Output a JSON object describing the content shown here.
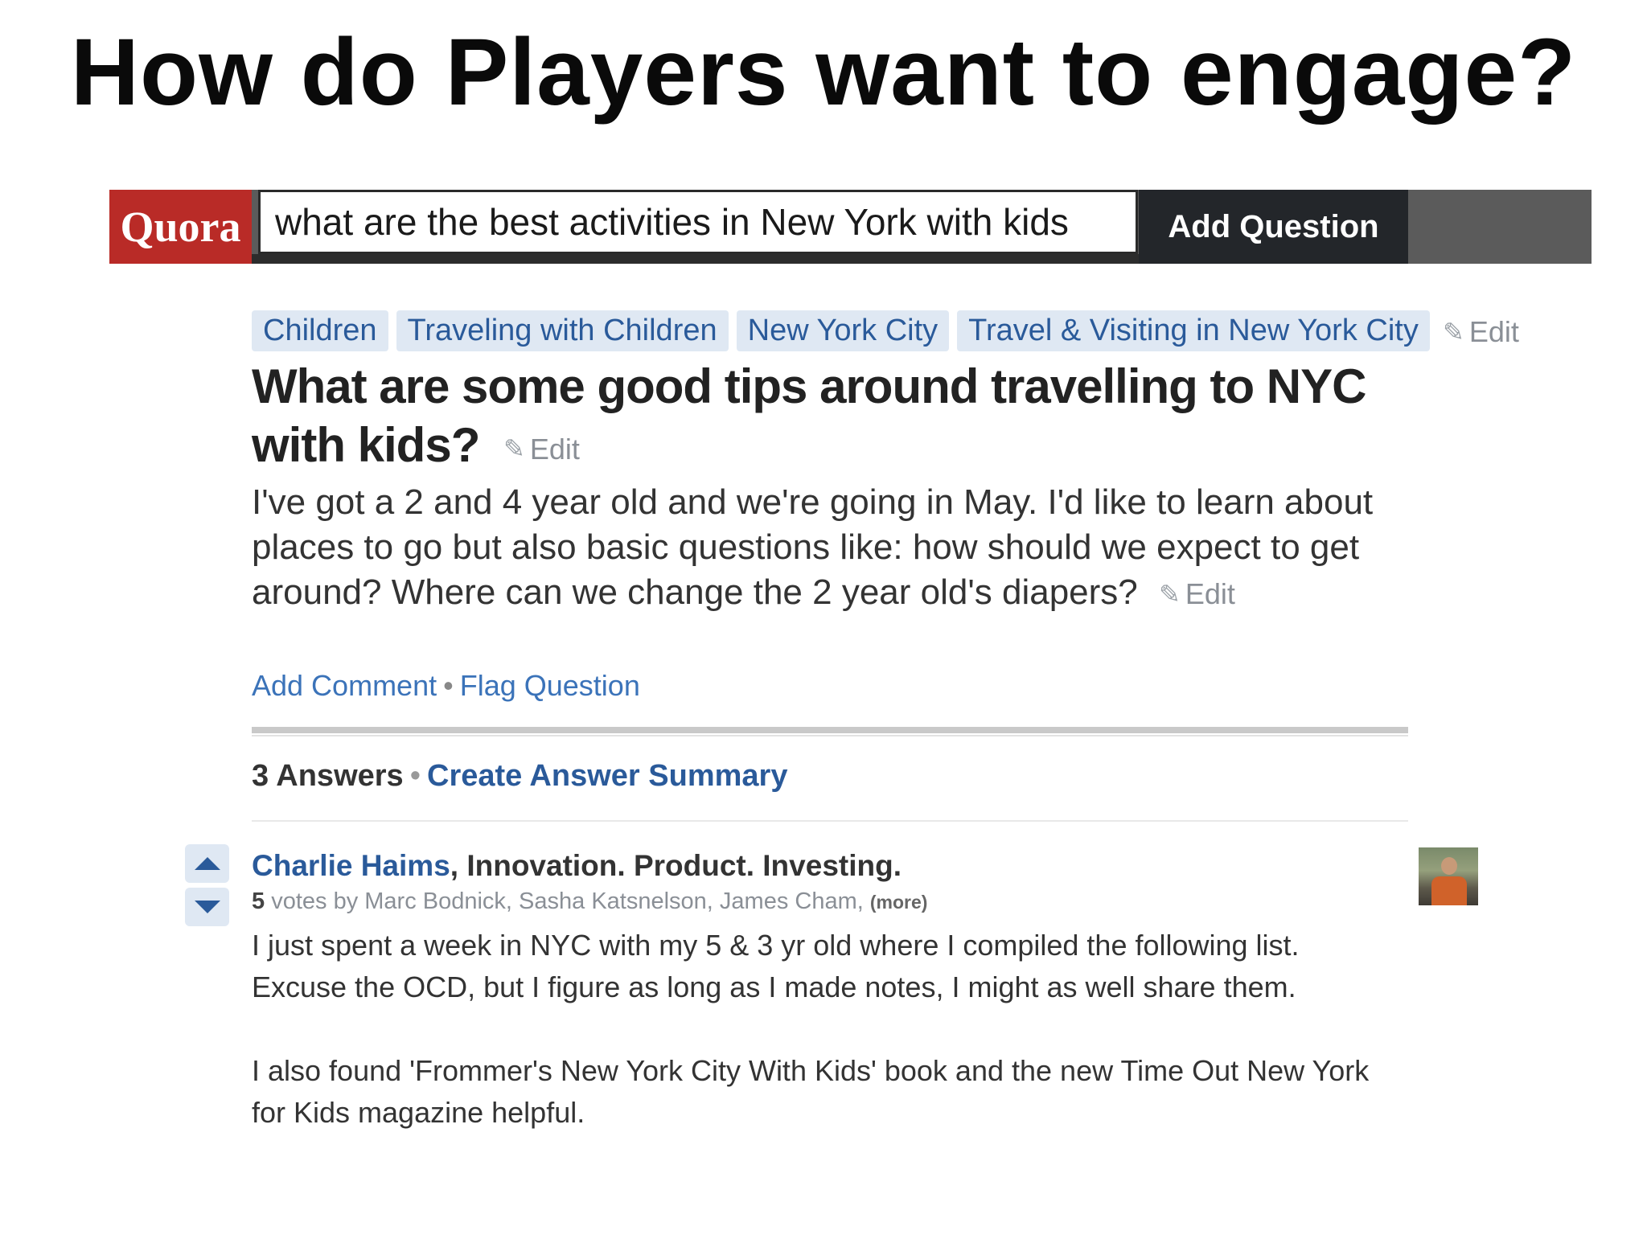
{
  "slide": {
    "title": "How do Players want to engage?"
  },
  "header": {
    "logo": "Quora",
    "search_value": "what are the best activities in New York with kids",
    "add_question_label": "Add Question"
  },
  "topics": [
    "Children",
    "Traveling with Children",
    "New York City",
    "Travel & Visiting in New York City"
  ],
  "edit_label": "Edit",
  "question": {
    "title": "What are some good tips around travelling to NYC with kids?",
    "details": "I've got a 2 and 4 year old and we're going in May. I'd like to learn about places to go but also basic questions like: how should we expect to get around? Where can we change the 2 year old's diapers?",
    "add_comment": "Add Comment",
    "separator": "•",
    "flag_question": "Flag Question"
  },
  "answers": {
    "count_label": "3 Answers",
    "create_summary": "Create Answer Summary"
  },
  "answer": {
    "author_name": "Charlie Haims",
    "author_bio": ", Innovation. Product. Investing.",
    "vote_count": "5",
    "votes_text": " votes by Marc Bodnick, Sasha Katsnelson, James Cham, ",
    "more": "(more)",
    "body": [
      "I just spent a week in NYC with my 5 & 3 yr old where I compiled the following list. Excuse the OCD, but I figure as long as I made notes, I might as well share them.",
      "I also found 'Frommer's New York City With Kids' book and the new Time Out New York for Kids magazine helpful."
    ]
  },
  "icons": {
    "edit": "pencil-icon",
    "upvote": "arrow-up-icon",
    "downvote": "arrow-down-icon"
  },
  "colors": {
    "quora_brand": "#b92b27",
    "link_blue": "#2a5a9a",
    "tag_bg": "#dfe8f3",
    "header_dark": "#23262a"
  }
}
